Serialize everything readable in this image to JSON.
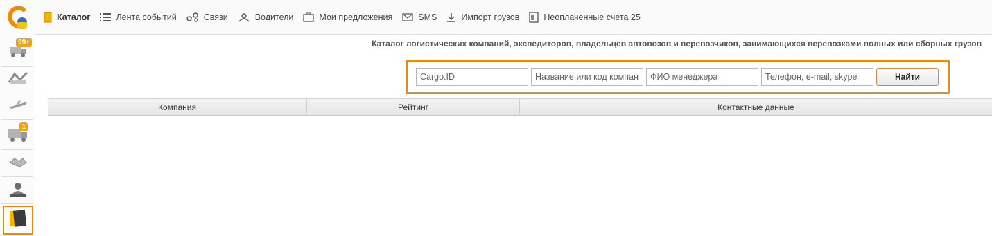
{
  "rail": {
    "items": [
      {
        "icon": "truck-stack-icon",
        "badge": "99+"
      },
      {
        "icon": "map-route-icon",
        "badge": ""
      },
      {
        "icon": "airplane-icon",
        "badge": ""
      },
      {
        "icon": "truck-icon",
        "badge": "1"
      },
      {
        "icon": "handshake-icon",
        "badge": ""
      },
      {
        "icon": "person-at-desk-icon",
        "badge": ""
      },
      {
        "icon": "catalog-book-icon",
        "badge": ""
      }
    ],
    "accent": "#f08a00"
  },
  "menu": {
    "catalog": "Каталог",
    "feed": "Лента событий",
    "links": "Связи",
    "drivers": "Водители",
    "offers": "Мои предложения",
    "sms": "SMS",
    "import": "Импорт грузов",
    "unpaid": "Неоплаченные счета 25"
  },
  "page": {
    "subtitle": "Каталог логистических компаний, экспедиторов, владельцев автовозов и перевозчиков, занимающихся перевозками полных или сборных грузов"
  },
  "search": {
    "cargo_id_placeholder": "Cargo.ID",
    "company_placeholder": "Название или код компании",
    "manager_placeholder": "ФИО менеджера",
    "contact_placeholder": "Телефон, e-mail, skype",
    "button": "Найти"
  },
  "table": {
    "columns": [
      "Компания",
      "Рейтинг",
      "Контактные данные"
    ]
  }
}
